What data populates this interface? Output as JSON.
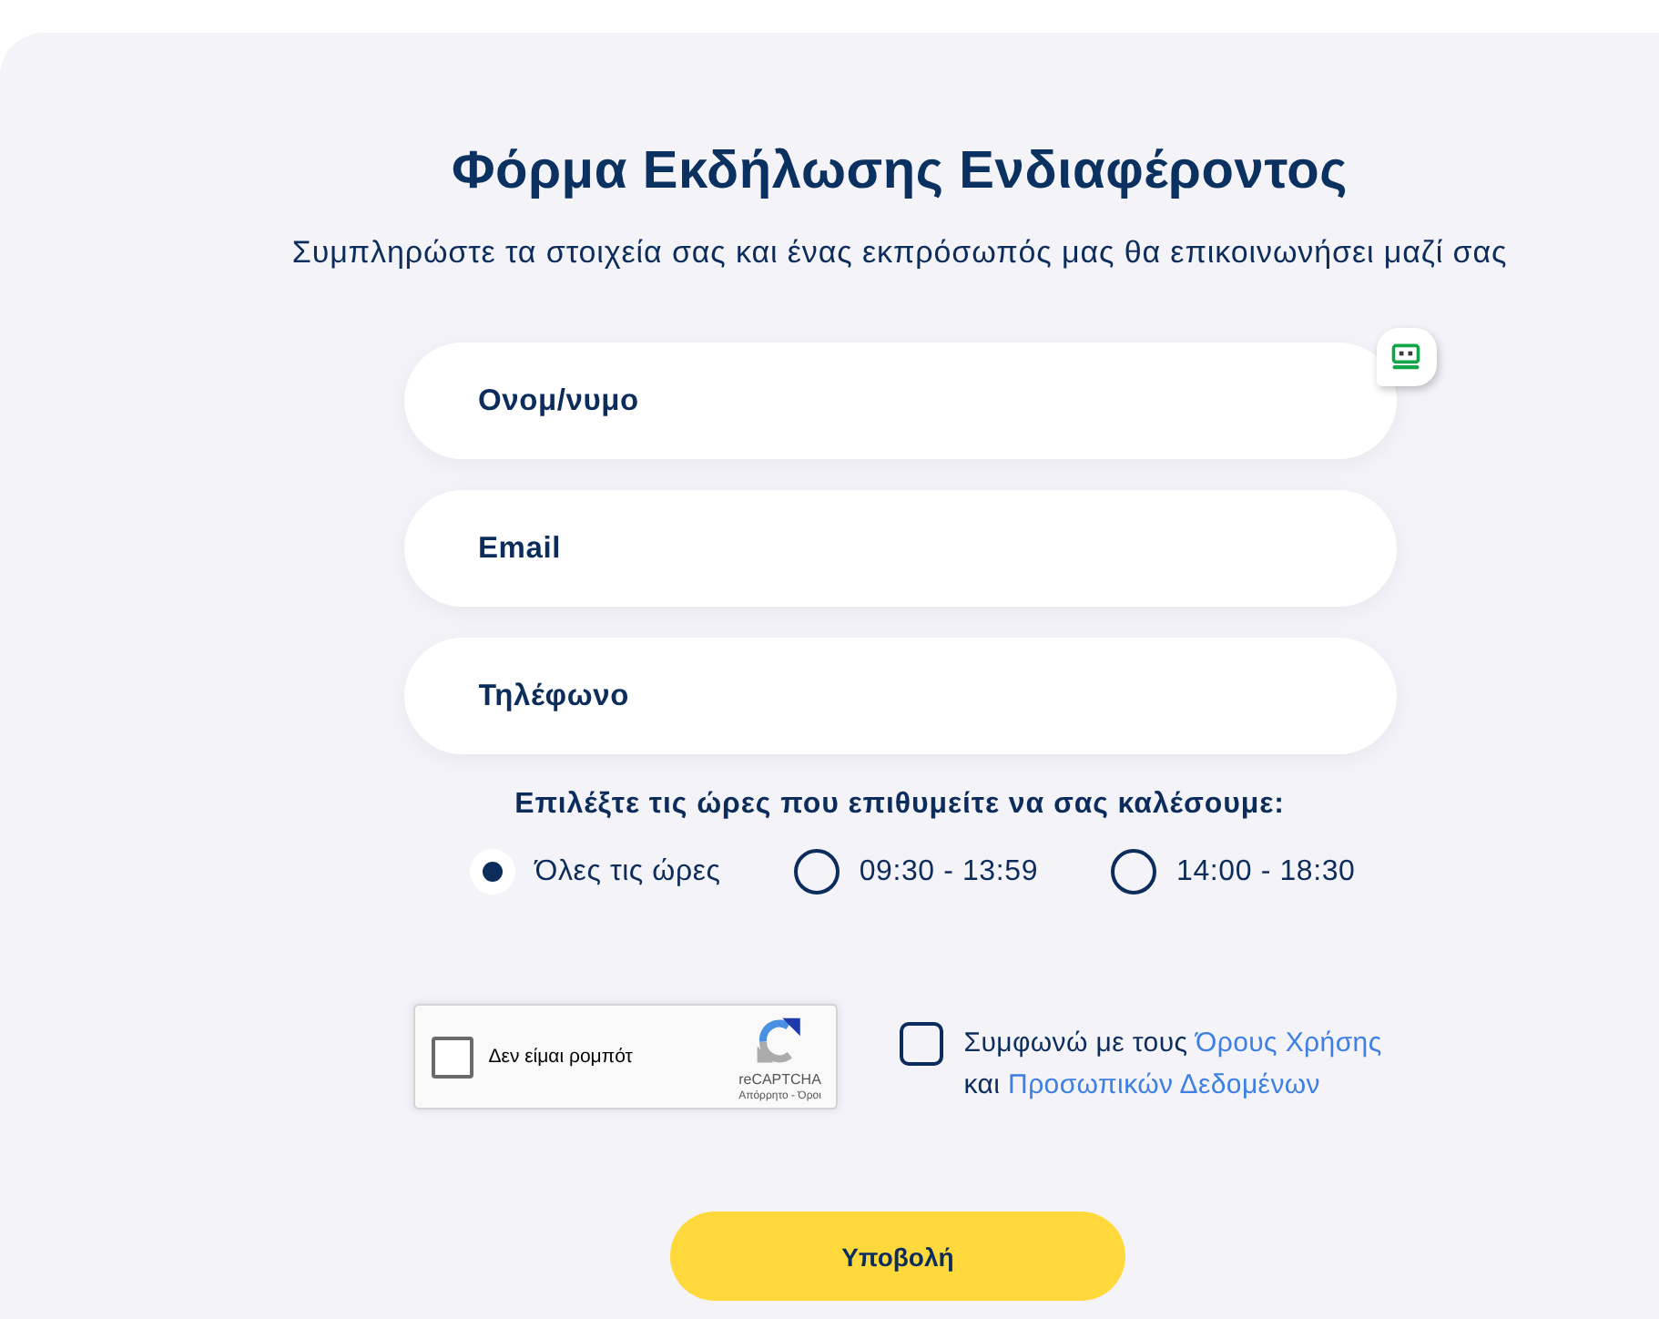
{
  "title": "Φόρμα Εκδήλωσης Ενδιαφέροντος",
  "subtitle": "Συμπληρώστε τα στοιχεία σας και ένας εκπρόσωπός μας θα επικοινωνήσει μαζί σας",
  "fields": [
    {
      "placeholder": "Ονομ/νυμο",
      "autofill_badge": true
    },
    {
      "placeholder": "Email",
      "autofill_badge": false
    },
    {
      "placeholder": "Τηλέφωνο",
      "autofill_badge": false
    }
  ],
  "call_times": {
    "label": "Επιλέξτε τις ώρες που επιθυμείτε να σας καλέσουμε:",
    "options": [
      {
        "label": "Όλες τις ώρες",
        "selected": true
      },
      {
        "label": "09:30 - 13:59",
        "selected": false
      },
      {
        "label": "14:00 - 18:30",
        "selected": false
      }
    ]
  },
  "captcha": {
    "label": "Δεν είμαι ρομπότ",
    "checked": false,
    "brand": "reCAPTCHA",
    "footer": "Απόρρητο - Όροι"
  },
  "consent": {
    "checked": false,
    "lines": [
      [
        {
          "kind": "text",
          "text": "Συμφωνώ με τους "
        },
        {
          "kind": "link",
          "text": "Όρους Χρήσης"
        }
      ],
      [
        {
          "kind": "text",
          "text": "και "
        },
        {
          "kind": "link",
          "text": "Προσωπικών Δεδομένων"
        }
      ]
    ]
  },
  "submit": {
    "label": "Υποβολή"
  }
}
